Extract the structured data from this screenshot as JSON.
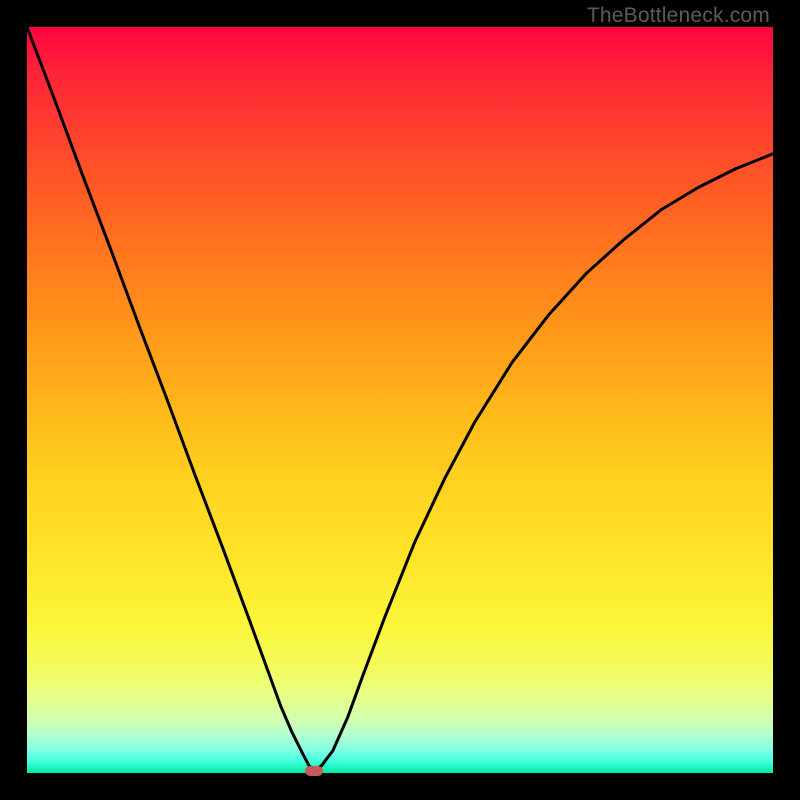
{
  "watermark": "TheBottleneck.com",
  "chart_data": {
    "type": "line",
    "title": "",
    "xlabel": "",
    "ylabel": "",
    "xlim": [
      0,
      1
    ],
    "ylim": [
      0,
      1
    ],
    "grid": false,
    "series": [
      {
        "name": "bottleneck-curve",
        "x": [
          0.0,
          0.038,
          0.075,
          0.113,
          0.15,
          0.188,
          0.225,
          0.263,
          0.3,
          0.32,
          0.34,
          0.355,
          0.37,
          0.378,
          0.385,
          0.395,
          0.41,
          0.43,
          0.45,
          0.48,
          0.52,
          0.56,
          0.6,
          0.65,
          0.7,
          0.75,
          0.8,
          0.85,
          0.9,
          0.95,
          1.0
        ],
        "y": [
          1.0,
          0.9,
          0.8,
          0.7,
          0.6,
          0.5,
          0.4,
          0.3,
          0.2,
          0.145,
          0.09,
          0.055,
          0.025,
          0.01,
          0.003,
          0.01,
          0.03,
          0.075,
          0.13,
          0.21,
          0.31,
          0.395,
          0.47,
          0.55,
          0.615,
          0.67,
          0.715,
          0.755,
          0.785,
          0.81,
          0.83
        ]
      }
    ],
    "marker": {
      "x": 0.385,
      "y": 0.003
    },
    "gradient_stops": [
      {
        "pos": 0.0,
        "color": "#ff0340"
      },
      {
        "pos": 0.5,
        "color": "#ffb41a"
      },
      {
        "pos": 0.8,
        "color": "#fbf53a"
      },
      {
        "pos": 1.0,
        "color": "#00e9a3"
      }
    ]
  }
}
